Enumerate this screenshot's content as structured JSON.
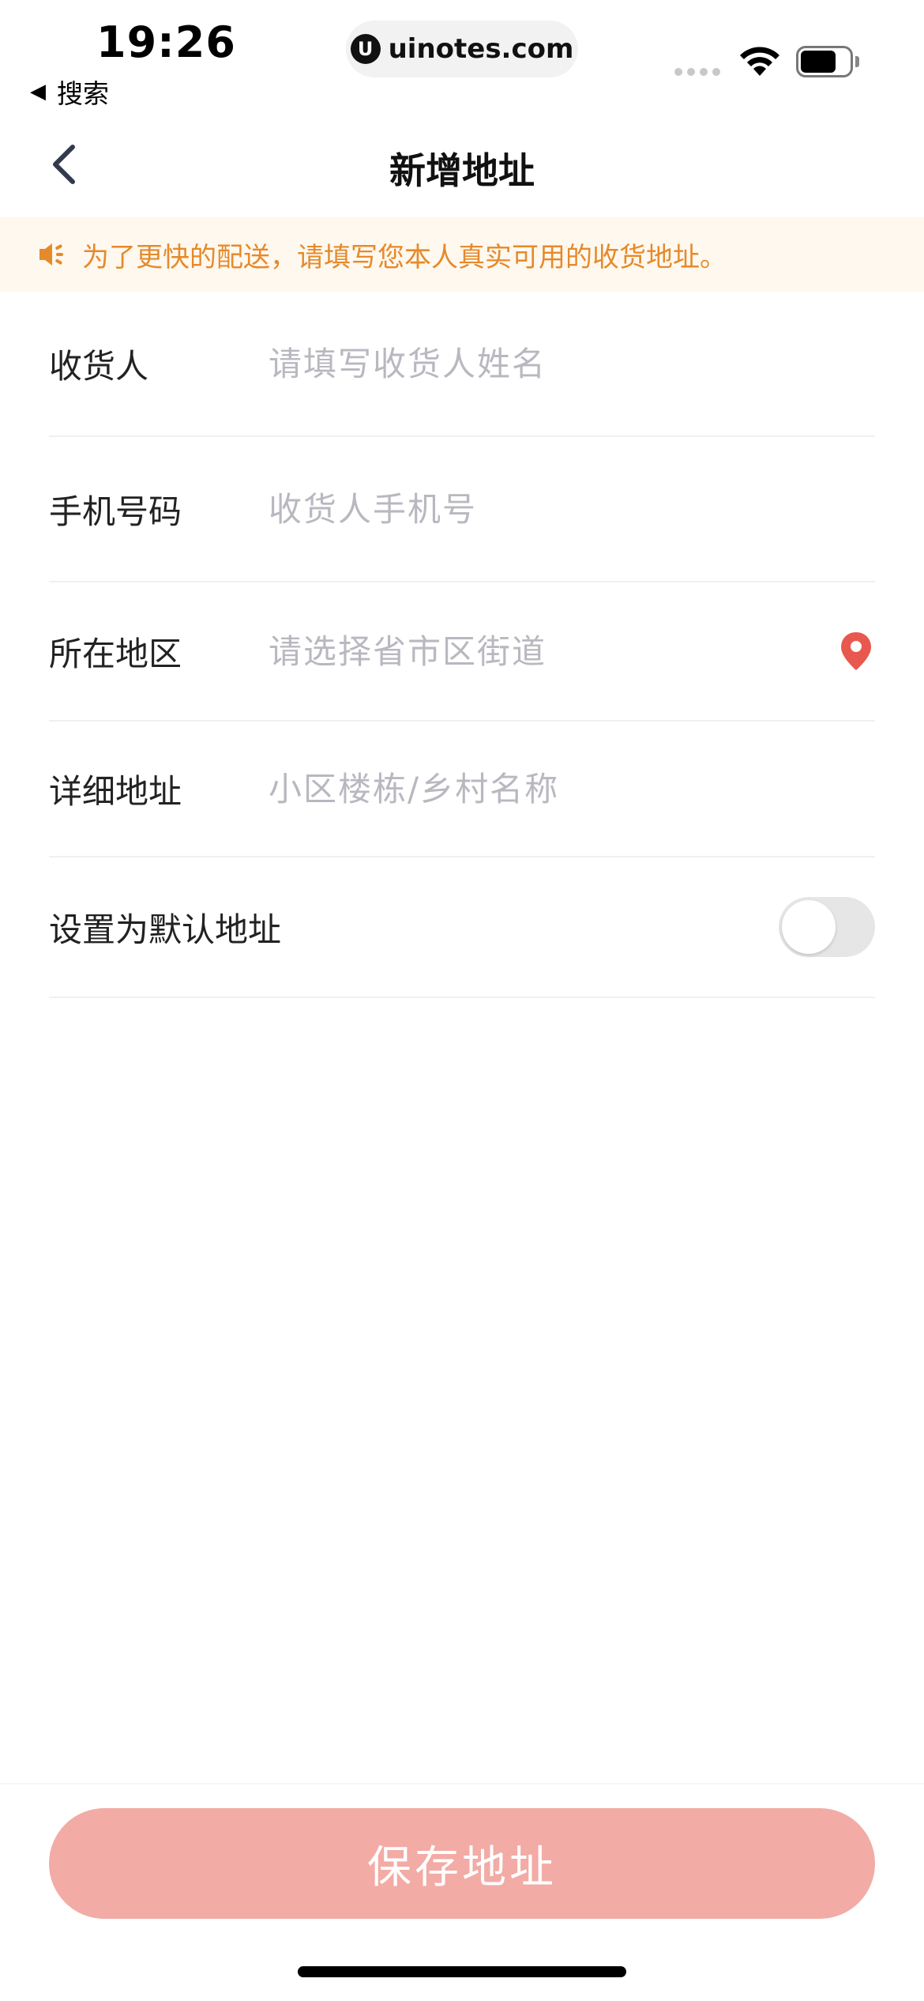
{
  "status_bar": {
    "time": "19:26",
    "back_app_label": "搜索",
    "url": "uinotes.com",
    "url_icon_letter": "U"
  },
  "nav": {
    "title": "新增地址"
  },
  "notice": {
    "text": "为了更快的配送，请填写您本人真实可用的收货地址。",
    "color": "#e58a2c"
  },
  "form": {
    "receiver": {
      "label": "收货人",
      "placeholder": "请填写收货人姓名",
      "value": ""
    },
    "phone": {
      "label": "手机号码",
      "placeholder": "收货人手机号",
      "value": ""
    },
    "region": {
      "label": "所在地区",
      "placeholder": "请选择省市区街道",
      "value": ""
    },
    "detail": {
      "label": "详细地址",
      "placeholder": "小区楼栋/乡村名称",
      "value": ""
    },
    "default_switch": {
      "label": "设置为默认地址",
      "on": false
    }
  },
  "footer": {
    "save_label": "保存地址",
    "button_color": "#f2aba5"
  },
  "icons": {
    "back": "chevron-left-icon",
    "notice": "speaker-icon",
    "region": "location-pin-icon"
  }
}
